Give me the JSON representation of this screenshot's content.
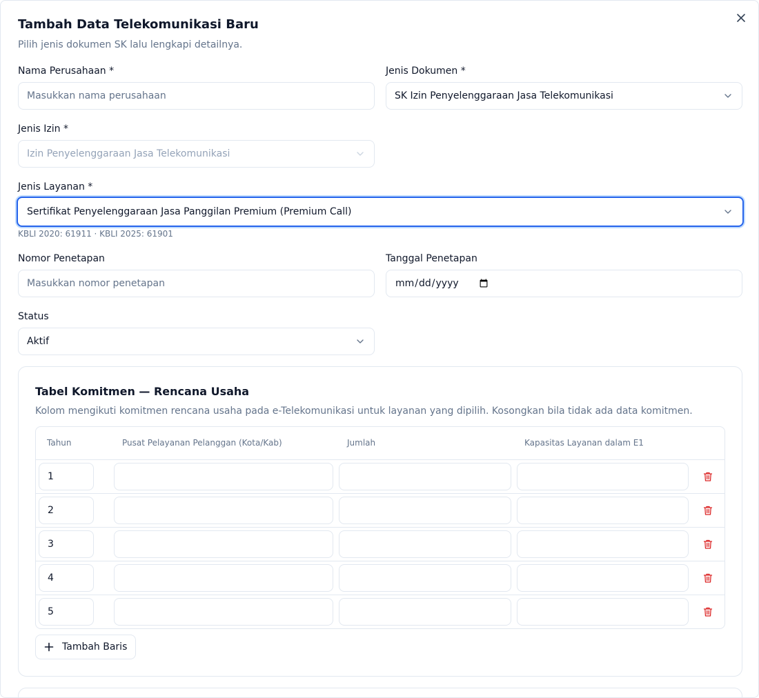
{
  "dialog": {
    "title": "Tambah Data Telekomunikasi Baru",
    "subtitle": "Pilih jenis dokumen SK lalu lengkapi detailnya.",
    "close_icon": "close-icon"
  },
  "form": {
    "nama_perusahaan": {
      "label": "Nama Perusahaan *",
      "value": "",
      "placeholder": "Masukkan nama perusahaan"
    },
    "jenis_dokumen": {
      "label": "Jenis Dokumen *",
      "value": "SK Izin Penyelenggaraan Jasa Telekomunikasi"
    },
    "jenis_izin": {
      "label": "Jenis Izin *",
      "value": "Izin Penyelenggaraan Jasa Telekomunikasi",
      "disabled": true
    },
    "jenis_layanan": {
      "label": "Jenis Layanan *",
      "value": "Sertifikat Penyelenggaraan Jasa Panggilan Premium (Premium Call)",
      "hint": "KBLI 2020: 61911 · KBLI 2025: 61901"
    },
    "nomor_penetapan": {
      "label": "Nomor Penetapan",
      "value": "",
      "placeholder": "Masukkan nomor penetapan"
    },
    "tanggal_penetapan": {
      "label": "Tanggal Penetapan",
      "value": ""
    },
    "status": {
      "label": "Status",
      "value": "Aktif"
    }
  },
  "komitmen": {
    "title": "Tabel Komitmen — Rencana Usaha",
    "description": "Kolom mengikuti komitmen rencana usaha pada e-Telekomunikasi untuk layanan yang dipilih. Kosongkan bila tidak ada data komitmen.",
    "columns": [
      "Tahun",
      "Pusat Pelayanan Pelanggan (Kota/Kab)",
      "Jumlah",
      "Kapasitas Layanan dalam E1"
    ],
    "rows": [
      {
        "tahun": "1",
        "pusat": "",
        "jumlah": "",
        "kapasitas": ""
      },
      {
        "tahun": "2",
        "pusat": "",
        "jumlah": "",
        "kapasitas": ""
      },
      {
        "tahun": "3",
        "pusat": "",
        "jumlah": "",
        "kapasitas": ""
      },
      {
        "tahun": "4",
        "pusat": "",
        "jumlah": "",
        "kapasitas": ""
      },
      {
        "tahun": "5",
        "pusat": "",
        "jumlah": "",
        "kapasitas": ""
      }
    ],
    "add_row_label": "Tambah Baris"
  },
  "colors": {
    "focus_ring": "#2563eb",
    "danger": "#dc2626",
    "muted_text": "#64748b",
    "border": "#e2e8f0"
  }
}
